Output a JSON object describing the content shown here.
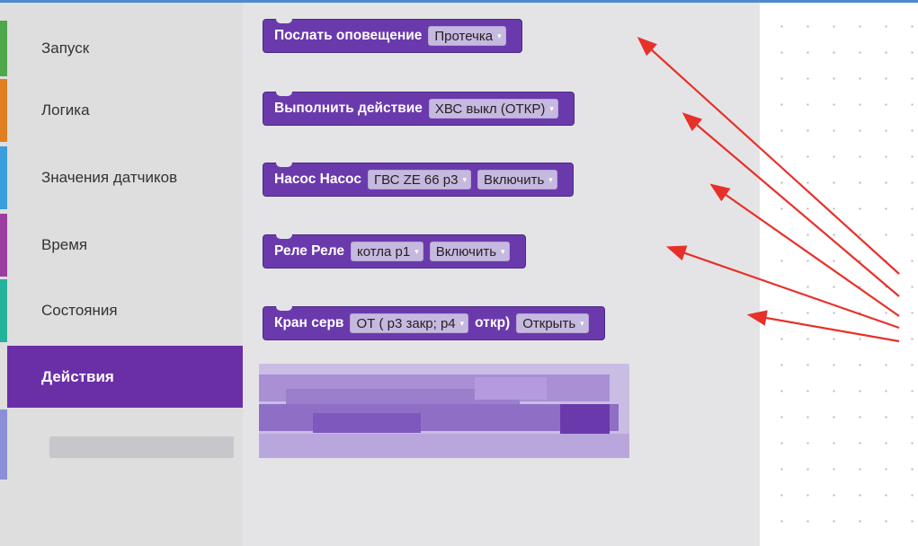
{
  "toolbox": {
    "categories": [
      {
        "label": "Запуск",
        "color": "#4ca84a"
      },
      {
        "label": "Логика",
        "color": "#e07f22"
      },
      {
        "label": "Значения датчиков",
        "color": "#3a9edc"
      },
      {
        "label": "Время",
        "color": "#9a3e9f"
      },
      {
        "label": "Состояния",
        "color": "#22b39a"
      },
      {
        "label": "Действия",
        "color": "#6a2fa6",
        "active": true
      }
    ],
    "blurred_item_color": "#8a8fd6"
  },
  "blocks": [
    {
      "segments": [
        {
          "type": "text",
          "value": "Послать оповещение"
        },
        {
          "type": "dropdown",
          "value": "Протечка"
        }
      ]
    },
    {
      "segments": [
        {
          "type": "text",
          "value": "Выполнить действие"
        },
        {
          "type": "dropdown",
          "value": "ХВС выкл (ОТКР)"
        }
      ]
    },
    {
      "segments": [
        {
          "type": "text",
          "value": "Насос Насос"
        },
        {
          "type": "dropdown",
          "value": "ГВС ZE 66 p3"
        },
        {
          "type": "dropdown",
          "value": "Включить"
        }
      ]
    },
    {
      "segments": [
        {
          "type": "text",
          "value": "Реле Реле"
        },
        {
          "type": "dropdown",
          "value": "котла p1"
        },
        {
          "type": "dropdown",
          "value": "Включить"
        }
      ]
    },
    {
      "segments": [
        {
          "type": "text",
          "value": "Кран серв"
        },
        {
          "type": "dropdown",
          "value": "ОТ ( p3 закр; p4"
        },
        {
          "type": "text",
          "value": "откр)"
        },
        {
          "type": "dropdown",
          "value": "Открыть"
        }
      ]
    }
  ],
  "colors": {
    "block_fill": "#6a3aad",
    "dropdown_fill": "#c6b9df",
    "annotation_arrow": "#e8302a"
  },
  "icons": {
    "dropdown_arrow": "▾"
  }
}
